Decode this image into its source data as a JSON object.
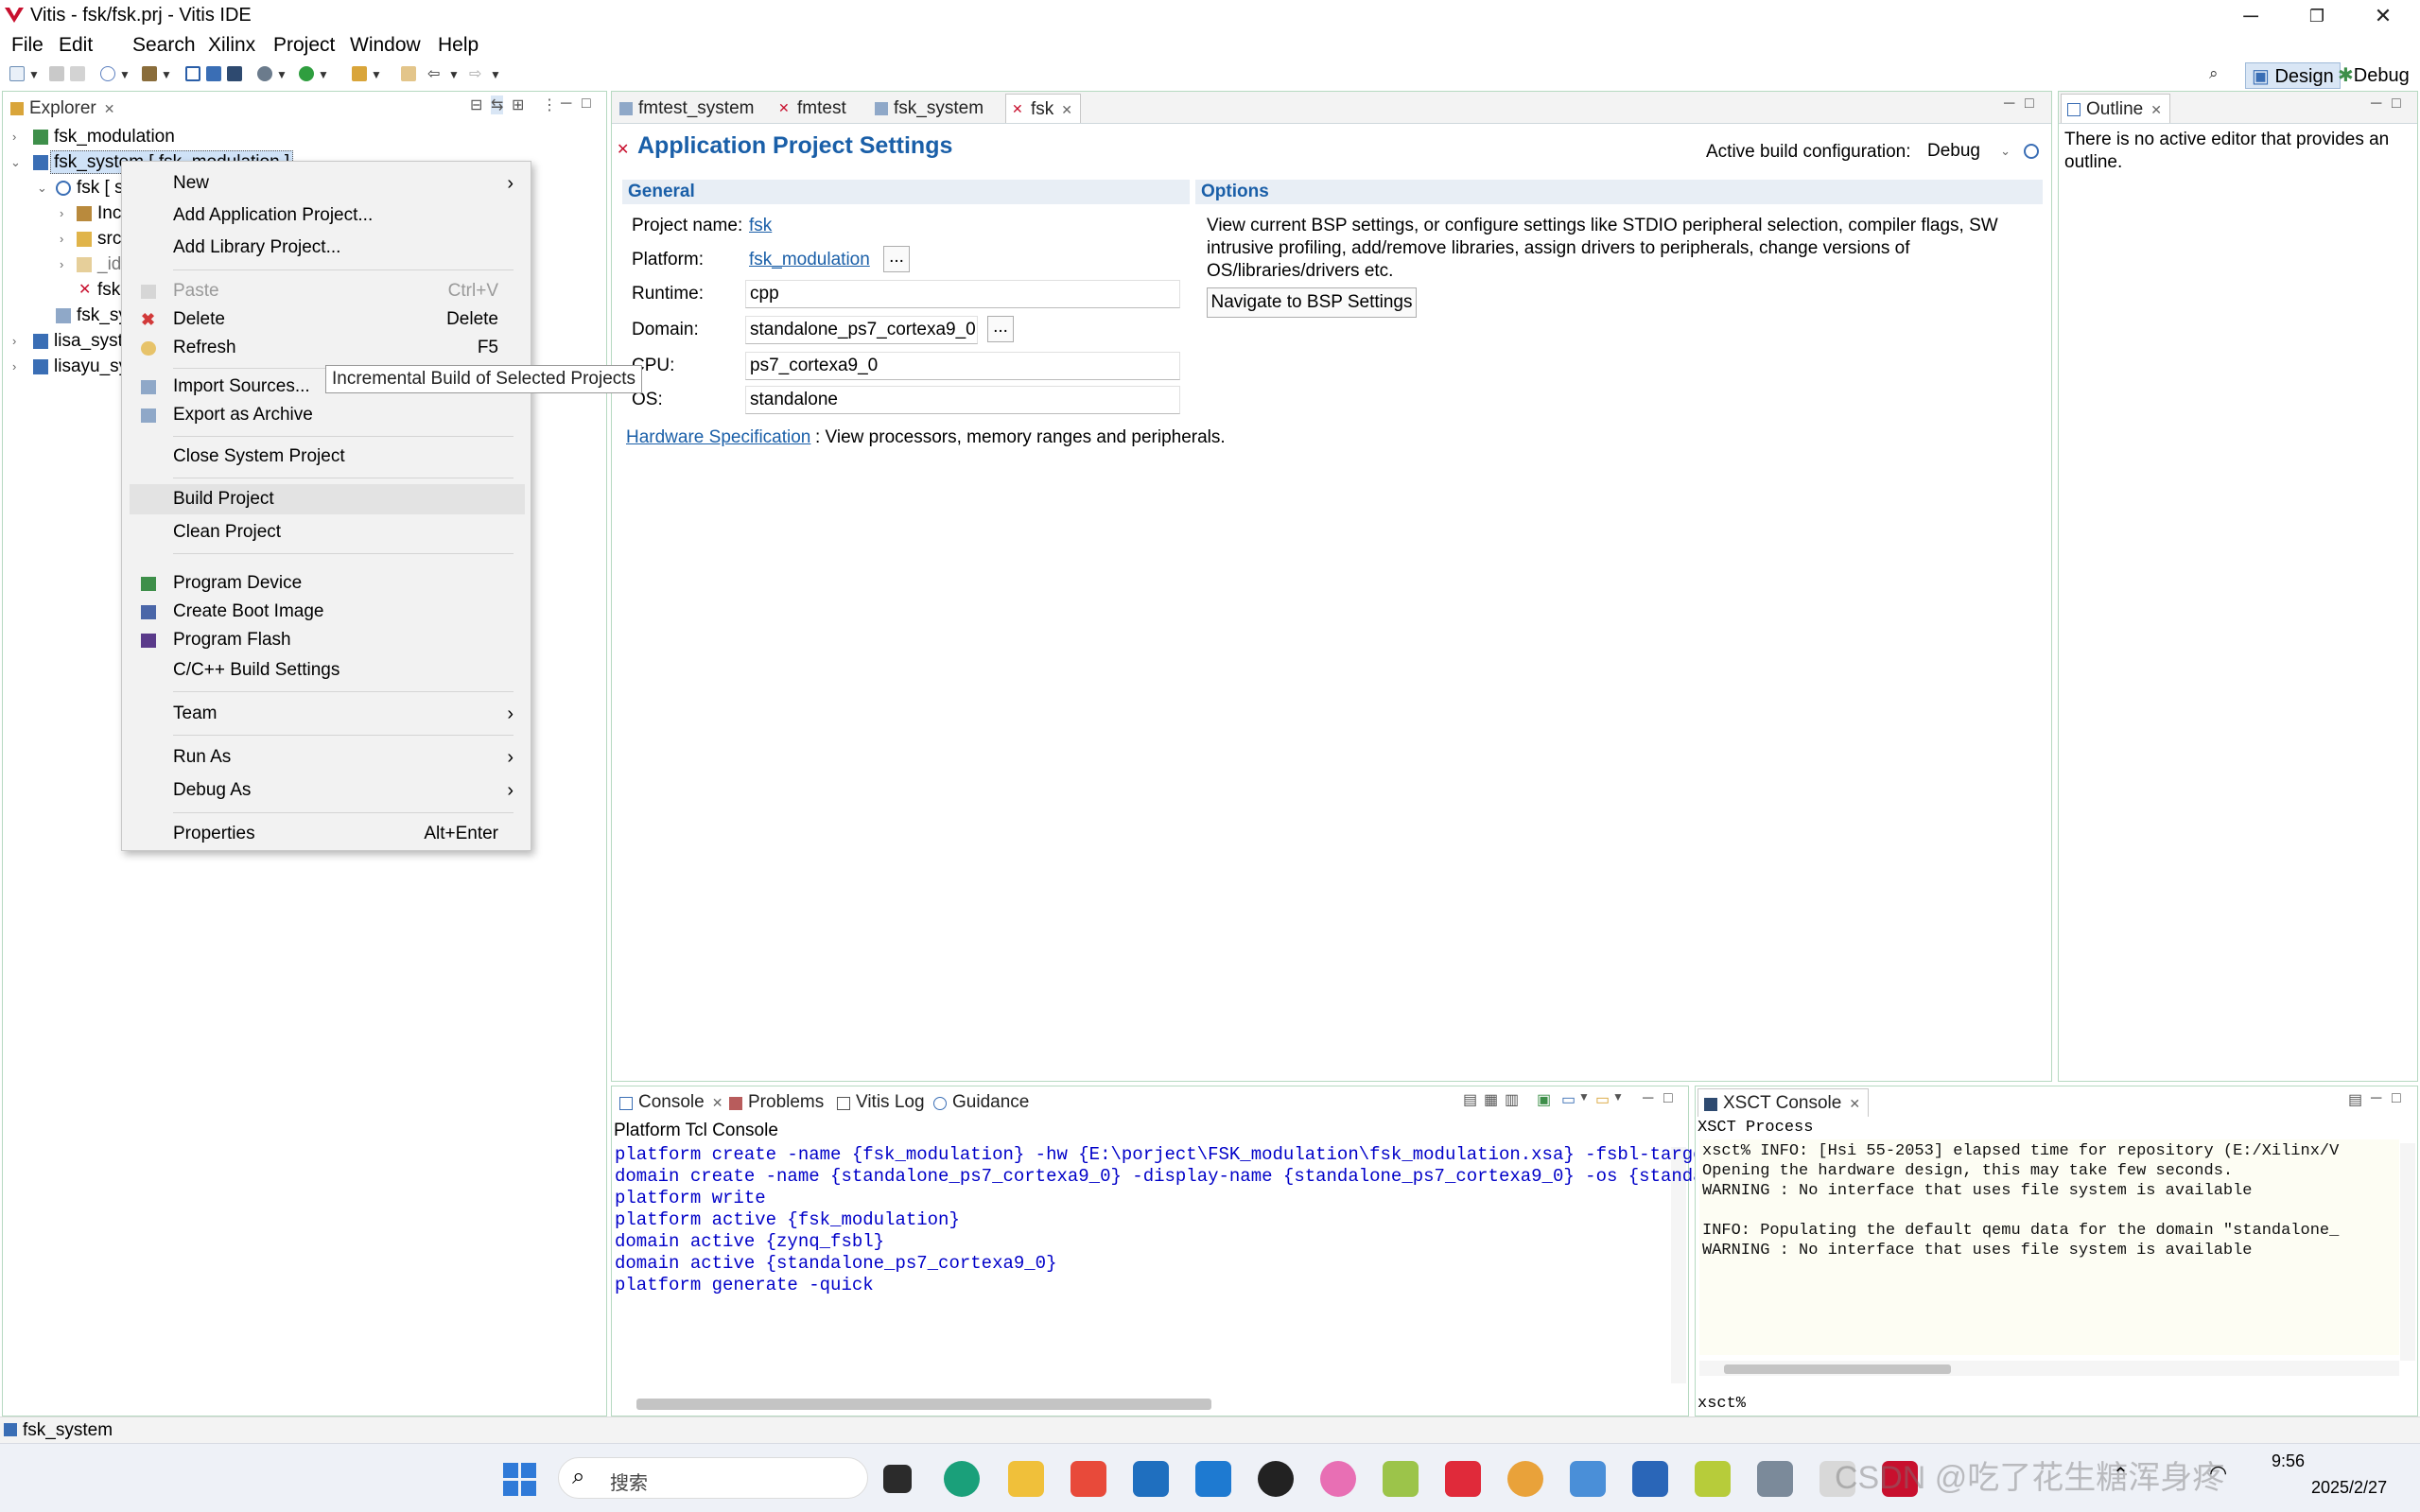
{
  "window": {
    "title": "Vitis - fsk/fsk.prj - Vitis IDE"
  },
  "menu": [
    "File",
    "Edit",
    "Search",
    "Xilinx",
    "Project",
    "Window",
    "Help"
  ],
  "perspectives": {
    "design": "Design",
    "debug": "Debug"
  },
  "explorer": {
    "tab": "Explorer",
    "items": {
      "fsk_modulation": "fsk_modulation",
      "fsk_system": "fsk_system [ fsk_modulation ]",
      "fsk_app": "fsk [ s",
      "inc": "Inc",
      "src": "src",
      "ide": "_id",
      "fsk_prj": "fsk",
      "fsk_sys_sub": "fsk_sy",
      "lisa_system": "lisa_syste",
      "lisayu_system": "lisayu_sy"
    }
  },
  "context_menu": {
    "new": "New",
    "add_app": "Add Application Project...",
    "add_lib": "Add Library Project...",
    "paste": "Paste",
    "paste_sc": "Ctrl+V",
    "delete": "Delete",
    "delete_sc": "Delete",
    "refresh": "Refresh",
    "refresh_sc": "F5",
    "import": "Import Sources...",
    "export": "Export as Archive",
    "close_sys": "Close System Project",
    "build": "Build Project",
    "clean": "Clean Project",
    "program_device": "Program Device",
    "boot_image": "Create Boot Image",
    "program_flash": "Program Flash",
    "build_settings": "C/C++ Build Settings",
    "team": "Team",
    "run_as": "Run As",
    "debug_as": "Debug As",
    "properties": "Properties",
    "properties_sc": "Alt+Enter"
  },
  "tooltip": "Incremental Build of Selected Projects",
  "editor": {
    "tabs": [
      "fmtest_system",
      "fmtest",
      "fsk_system",
      "fsk"
    ],
    "heading": "Application Project Settings",
    "build_config_label": "Active build configuration:",
    "build_config_value": "Debug",
    "general": {
      "header": "General",
      "project_name_label": "Project name:",
      "project_name": "fsk",
      "platform_label": "Platform:",
      "platform": "fsk_modulation",
      "runtime_label": "Runtime:",
      "runtime": "cpp",
      "domain_label": "Domain:",
      "domain": "standalone_ps7_cortexa9_0",
      "cpu_label": "CPU:",
      "cpu": "ps7_cortexa9_0",
      "os_label": "OS:",
      "os": "standalone",
      "hw_link": "Hardware Specification",
      "hw_desc": ": View processors, memory ranges and peripherals.",
      "browse": "..."
    },
    "options": {
      "header": "Options",
      "line1": "View current BSP settings, or configure settings like STDIO peripheral selection, compiler flags, SW",
      "line2": "intrusive profiling, add/remove libraries, assign drivers to peripherals, change versions of",
      "line3": "OS/libraries/drivers etc.",
      "button": "Navigate to BSP Settings"
    }
  },
  "outline": {
    "tab": "Outline",
    "msg1": "There is no active editor that provides an",
    "msg2": "outline."
  },
  "console": {
    "tabs": [
      "Console",
      "Problems",
      "Vitis Log",
      "Guidance"
    ],
    "title": "Platform Tcl Console",
    "lines": [
      "platform create -name {fsk_modulation} -hw {E:\\porject\\FSK_modulation\\fsk_modulation.xsa} -fsbl-targe",
      "domain create -name {standalone_ps7_cortexa9_0} -display-name {standalone_ps7_cortexa9_0} -os {standa",
      "platform write",
      "platform active {fsk_modulation}",
      "domain active {zynq_fsbl}",
      "domain active {standalone_ps7_cortexa9_0}",
      "platform generate -quick"
    ]
  },
  "xsct": {
    "tab": "XSCT Console",
    "process": "XSCT Process",
    "lines": [
      "xsct% INFO: [Hsi 55-2053] elapsed time for repository (E:/Xilinx/V",
      "Opening the hardware design, this may take few seconds.",
      "WARNING : No interface that uses file system is available",
      "",
      "INFO: Populating the default qemu data for the domain \"standalone_",
      "WARNING : No interface that uses file system is available"
    ],
    "prompt": "xsct%"
  },
  "status": {
    "text": "fsk_system"
  },
  "taskbar": {
    "search": "搜索",
    "time": "9:56",
    "date": "2025/2/27",
    "watermark": "CSDN @吃了花生糖浑身疼"
  }
}
